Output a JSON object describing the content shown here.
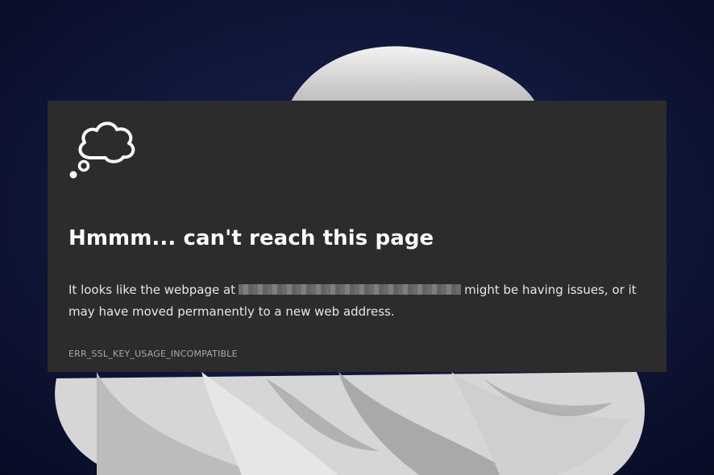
{
  "error_page": {
    "title": "Hmmm... can't reach this page",
    "message_before": "It looks like the webpage at",
    "message_after": "might be having issues, or it may have moved permanently to a new web address.",
    "error_code": "ERR_SSL_KEY_USAGE_INCOMPATIBLE",
    "icon": "thought-cloud-icon",
    "url_redacted": true
  },
  "colors": {
    "desktop_background": "#0a0f2e",
    "card_background": "#2c2c2c",
    "title_text": "#ffffff",
    "body_text": "#e6e6e6",
    "error_code_text": "#a8a8a8"
  }
}
